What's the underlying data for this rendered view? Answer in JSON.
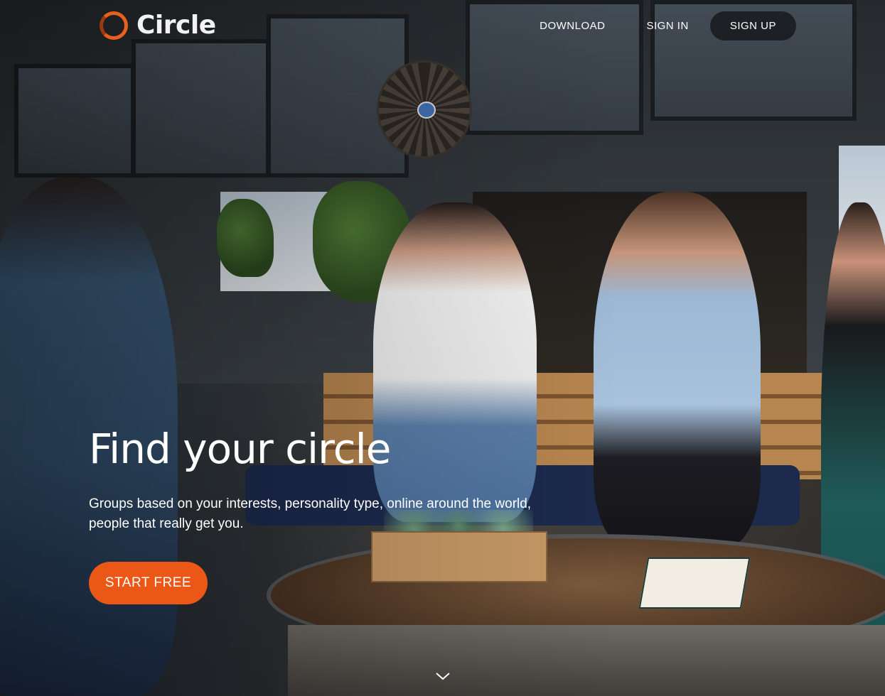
{
  "brand": {
    "name": "Circle",
    "accent": "#ea5716"
  },
  "nav": {
    "download": "DOWNLOAD",
    "sign_in": "SIGN IN",
    "sign_up": "SIGN UP"
  },
  "hero": {
    "title": "Find your circle",
    "subtitle_line1": "Groups based on your interests, personality type, online around the world,",
    "subtitle_line2": "people that really get you.",
    "cta": "START FREE"
  },
  "icons": {
    "logo": "circle-logo-icon",
    "scroll": "chevron-down-icon"
  }
}
